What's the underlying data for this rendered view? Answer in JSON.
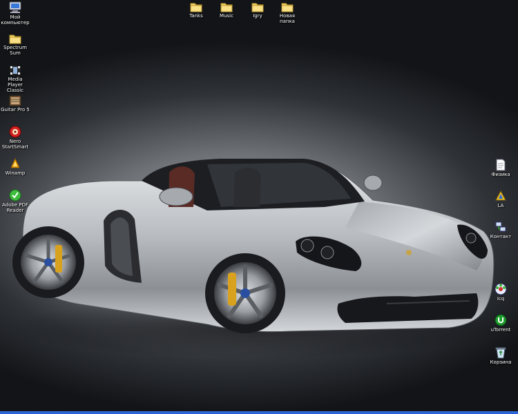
{
  "wallpaper": {
    "subject": "silver roadster sports car",
    "colors": {
      "bg_center": "#a9adb2",
      "bg_edge": "#121417",
      "car_body": "#c4c7cb"
    }
  },
  "desktop": {
    "left_icons": [
      {
        "label": "Мой компьютер",
        "icon": "my-computer-icon"
      },
      {
        "label": "Spectrum Sum",
        "icon": "folder-icon"
      },
      {
        "label": "Media Player Classic",
        "icon": "media-player-icon"
      },
      {
        "label": "Guitar Pro 5",
        "icon": "guitar-pro-icon"
      },
      {
        "label": "Nero StartSmart",
        "icon": "nero-icon"
      },
      {
        "label": "Winamp",
        "icon": "winamp-icon"
      },
      {
        "label": "Adobe PDF Reader",
        "icon": "adobe-reader-icon"
      }
    ],
    "top_icons": [
      {
        "label": "Tanks",
        "icon": "folder-icon"
      },
      {
        "label": "Music",
        "icon": "folder-icon"
      },
      {
        "label": "Igry",
        "icon": "folder-icon"
      },
      {
        "label": "Новая папка",
        "icon": "folder-icon"
      }
    ],
    "right_icons": [
      {
        "label": "Физика",
        "icon": "document-icon"
      },
      {
        "label": "LA",
        "icon": "shortcut-icon"
      },
      {
        "label": "Контакт",
        "icon": "network-icon"
      },
      {
        "label": "Icq",
        "icon": "icq-icon"
      },
      {
        "label": "uTorrent",
        "icon": "utorrent-icon"
      },
      {
        "label": "Корзина",
        "icon": "recycle-bin-icon"
      }
    ]
  }
}
